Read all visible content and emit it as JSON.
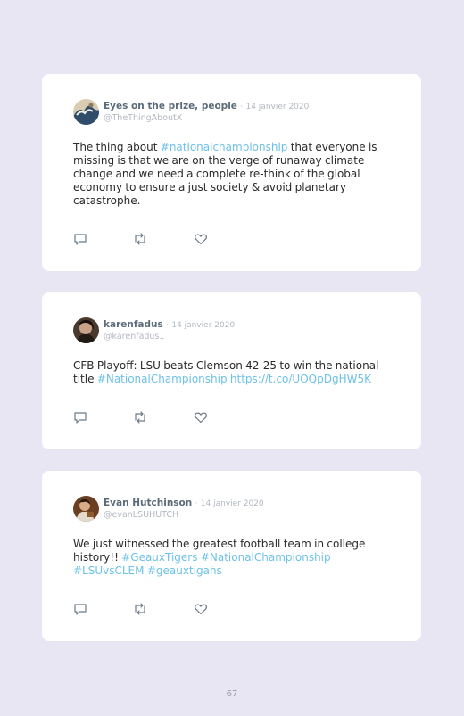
{
  "tweets": [
    {
      "name": "Eyes on the prize, people",
      "date": "14 janvier 2020",
      "handle": "@TheThingAboutX",
      "text_parts": [
        {
          "t": "The thing about "
        },
        {
          "t": "#nationalchampionship",
          "link": true
        },
        {
          "t": " that everyone is missing is that we are on the verge of runaway climate change and we need a complete re-think of the global economy to ensure a just society & avoid planetary catastrophe."
        }
      ]
    },
    {
      "name": "karenfadus",
      "date": "14 janvier 2020",
      "handle": "@karenfadus1",
      "text_parts": [
        {
          "t": "CFB Playoff: LSU beats Clemson 42-25 to win the national title "
        },
        {
          "t": "#NationalChampionship",
          "link": true
        },
        {
          "t": " "
        },
        {
          "t": "https://t.co/UOQpDgHW5K",
          "link": true
        }
      ]
    },
    {
      "name": "Evan Hutchinson",
      "date": "14 janvier 2020",
      "handle": "@evanLSUHUTCH",
      "text_parts": [
        {
          "t": "We just witnessed the greatest football team in college history!! "
        },
        {
          "t": "#GeauxTigers",
          "link": true
        },
        {
          "t": " "
        },
        {
          "t": "#NationalChampionship",
          "link": true
        },
        {
          "t": " "
        },
        {
          "t": "#LSUvsCLEM",
          "link": true
        },
        {
          "t": " "
        },
        {
          "t": "#geauxtigahs",
          "link": true
        }
      ]
    }
  ],
  "separator": "·",
  "icons": {
    "reply": "reply-icon",
    "retweet": "retweet-icon",
    "like": "heart-icon"
  },
  "colors": {
    "background": "#e9e6f3",
    "card": "#ffffff",
    "hashtag": "#6ec1e8",
    "name": "#5b6b7a"
  },
  "page_number": "67"
}
